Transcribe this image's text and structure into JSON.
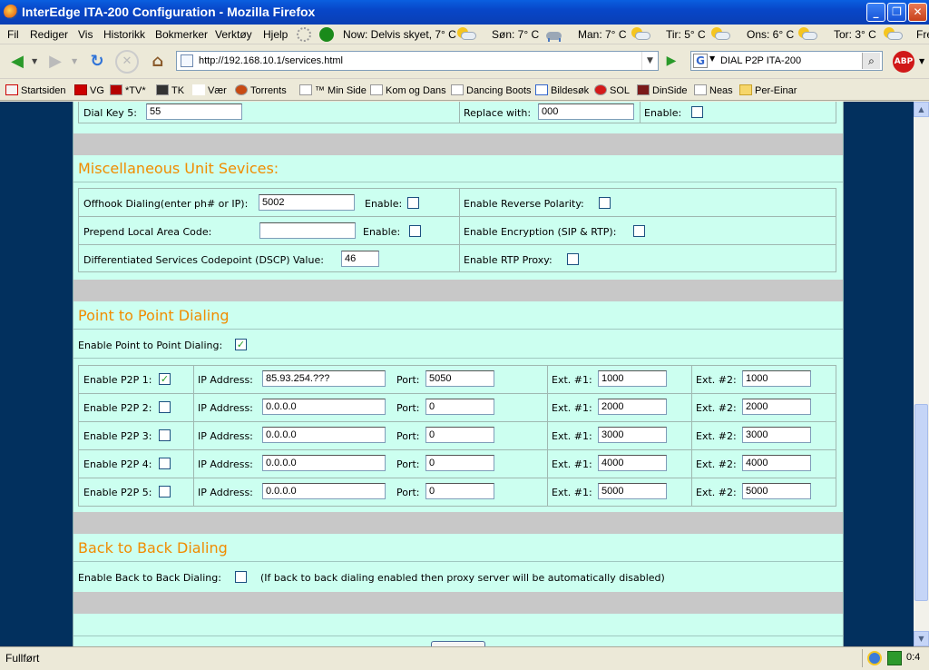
{
  "window": {
    "title": "InterEdge ITA-200 Configuration - Mozilla Firefox",
    "min": "_",
    "max": "❐",
    "close": "✕"
  },
  "menu": [
    "Fil",
    "Rediger",
    "Vis",
    "Historikk",
    "Bokmerker",
    "Verktøy",
    "Hjelp"
  ],
  "weather": {
    "now": "Now: Delvis skyet, 7° C",
    "forecast": [
      "Søn: 7° C",
      "Man: 7° C",
      "Tir: 5° C",
      "Ons: 6° C",
      "Tor: 3° C",
      "Fre"
    ]
  },
  "nav": {
    "url": "http://192.168.10.1/services.html",
    "search": "DIAL P2P ITA-200",
    "abp": "ABP"
  },
  "bookmarks": [
    "Startsiden",
    "VG",
    "*TV*",
    "TK",
    "Vær",
    "Torrents",
    "™ Min Side",
    "Kom og Dans",
    "Dancing Boots",
    "Bildesøk",
    "SOL",
    "DinSide",
    "Neas",
    "Per-Einar"
  ],
  "dial_key": {
    "label": "Dial Key 5:",
    "value": "55",
    "replace_label": "Replace with:",
    "replace_value": "000",
    "enable_label": "Enable:"
  },
  "misc": {
    "heading": "Miscellaneous Unit Sevices:",
    "offhook_label": "Offhook Dialing(enter ph# or IP):",
    "offhook_value": "5002",
    "offhook_enable_label": "Enable:",
    "reverse_polarity_label": "Enable Reverse Polarity:",
    "prepend_label": "Prepend Local Area Code:",
    "prepend_value": "",
    "prepend_enable_label": "Enable:",
    "encryption_label": "Enable Encryption (SIP & RTP):",
    "dscp_label": "Differentiated Services Codepoint (DSCP) Value:",
    "dscp_value": "46",
    "rtp_proxy_label": "Enable RTP Proxy:"
  },
  "p2p": {
    "heading": "Point to Point Dialing",
    "enable_label": "Enable Point to Point Dialing:",
    "ip_label": "IP Address:",
    "port_label": "Port:",
    "ext1_label": "Ext. #1:",
    "ext2_label": "Ext. #2:",
    "rows": [
      {
        "label": "Enable P2P 1:",
        "checked": true,
        "ip": "85.93.254.???",
        "port": "5050",
        "ext1": "1000",
        "ext2": "1000"
      },
      {
        "label": "Enable P2P 2:",
        "checked": false,
        "ip": "0.0.0.0",
        "port": "0",
        "ext1": "2000",
        "ext2": "2000"
      },
      {
        "label": "Enable P2P 3:",
        "checked": false,
        "ip": "0.0.0.0",
        "port": "0",
        "ext1": "3000",
        "ext2": "3000"
      },
      {
        "label": "Enable P2P 4:",
        "checked": false,
        "ip": "0.0.0.0",
        "port": "0",
        "ext1": "4000",
        "ext2": "4000"
      },
      {
        "label": "Enable P2P 5:",
        "checked": false,
        "ip": "0.0.0.0",
        "port": "0",
        "ext1": "5000",
        "ext2": "5000"
      }
    ]
  },
  "b2b": {
    "heading": "Back to Back Dialing",
    "enable_label": "Enable Back to Back Dialing:",
    "note": "(If back to back dialing enabled then proxy server will be automatically disabled)"
  },
  "status": {
    "text": "Fullført",
    "time": "0:4"
  },
  "checkmark": "✓"
}
